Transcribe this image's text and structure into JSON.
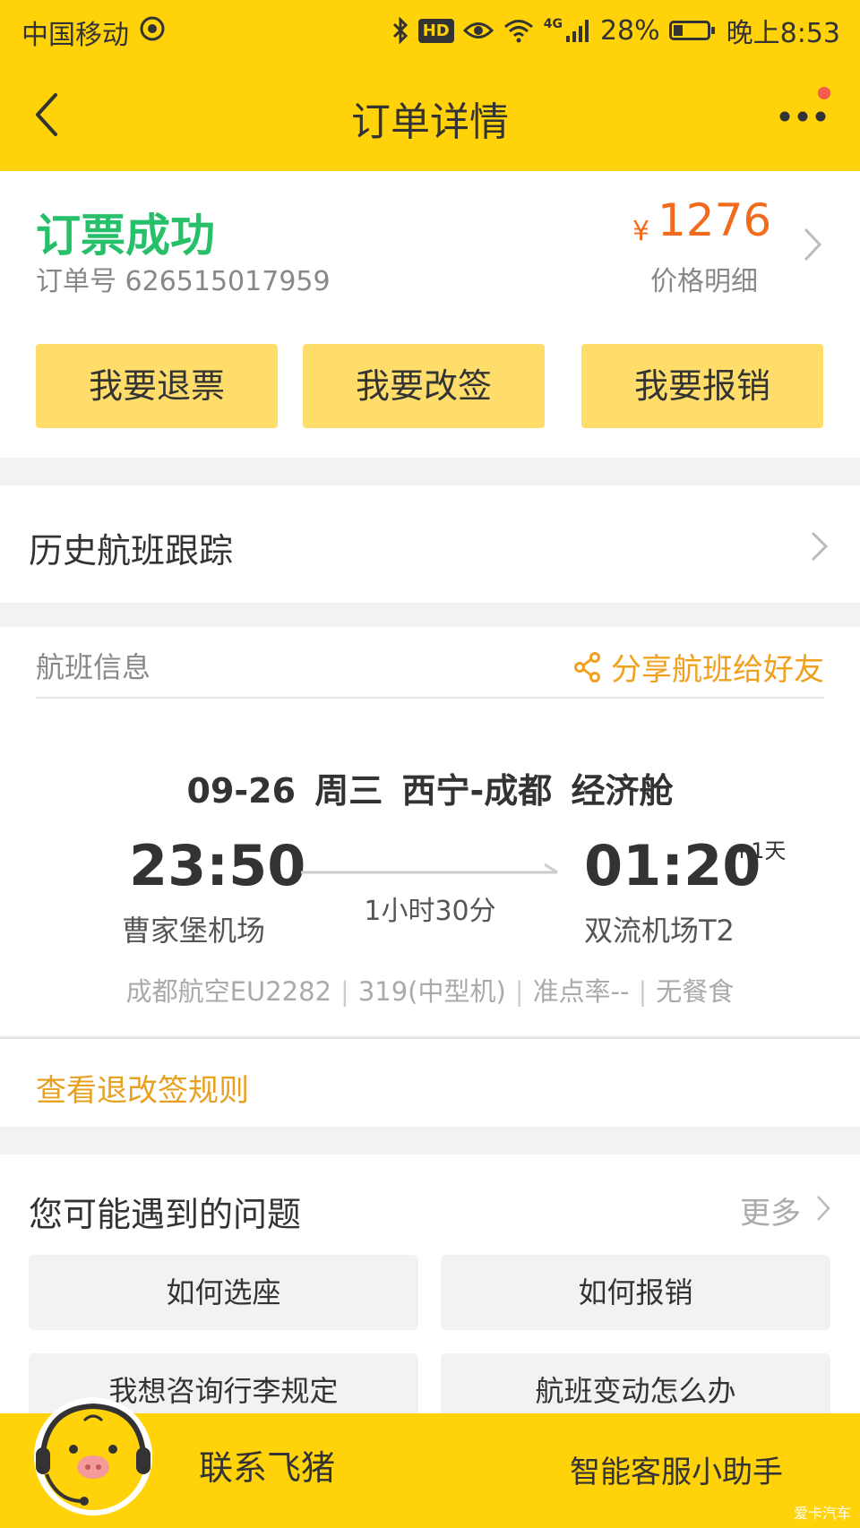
{
  "status_bar": {
    "carrier": "中国移动",
    "network": "4G",
    "battery": "28%",
    "battery_level": 0.28,
    "time": "晚上8:53",
    "hd": "HD"
  },
  "nav": {
    "title": "订单详情"
  },
  "order": {
    "status": "订票成功",
    "order_number": "订单号 626515017959",
    "currency": "¥",
    "price": "1276",
    "price_detail": "价格明细",
    "actions": [
      "我要退票",
      "我要改签",
      "我要报销"
    ]
  },
  "history": {
    "label": "历史航班跟踪"
  },
  "flight": {
    "section_title": "航班信息",
    "share_label": "分享航班给好友",
    "route_line": "09-26 周三 西宁-成都 经济舱",
    "departure_time": "23:50",
    "arrival_time": "01:20",
    "next_day": "+1天",
    "duration": "1小时30分",
    "departure_airport": "曹家堡机场",
    "arrival_airport": "双流机场T2",
    "meta": [
      "成都航空EU2282",
      "319(中型机)",
      "准点率--",
      "无餐食"
    ],
    "rules_link": "查看退改签规则"
  },
  "questions": {
    "title": "您可能遇到的问题",
    "more": "更多",
    "items": [
      "如何选座",
      "如何报销",
      "我想咨询行李规定",
      "航班变动怎么办"
    ]
  },
  "bottom_bar": {
    "contact": "联系飞猪",
    "assistant": "智能客服小助手"
  },
  "watermark": "爱卡汽车",
  "colors": {
    "brand_yellow": "#ffd20a",
    "button_yellow": "#fedd6a",
    "success_green": "#27c06a",
    "price_orange": "#f26b1d",
    "link_orange": "#e8a021"
  }
}
